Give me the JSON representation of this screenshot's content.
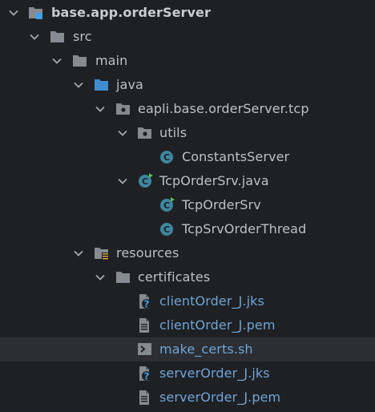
{
  "project_tree": {
    "root": {
      "label": "base.app.orderServer"
    },
    "src": {
      "label": "src"
    },
    "main": {
      "label": "main"
    },
    "java": {
      "label": "java"
    },
    "package": {
      "label": "eapli.base.orderServer.tcp"
    },
    "utils": {
      "label": "utils"
    },
    "constants_server": {
      "label": "ConstantsServer"
    },
    "tcp_order_srv_file": {
      "label": "TcpOrderSrv.java"
    },
    "tcp_order_srv_class": {
      "label": "TcpOrderSrv"
    },
    "tcp_srv_order_thread": {
      "label": "TcpSrvOrderThread"
    },
    "resources": {
      "label": "resources"
    },
    "certificates": {
      "label": "certificates"
    },
    "files": [
      {
        "label": "clientOrder_J.jks",
        "icon": "unknown-file-icon"
      },
      {
        "label": "clientOrder_J.pem",
        "icon": "text-file-icon"
      },
      {
        "label": "make_certs.sh",
        "icon": "shell-script-icon"
      },
      {
        "label": "serverOrder_J.jks",
        "icon": "unknown-file-icon"
      },
      {
        "label": "serverOrder_J.pem",
        "icon": "text-file-icon"
      }
    ]
  },
  "colors": {
    "background": "#1f2023",
    "selected_row": "#2c2e33",
    "text": "#bcc0c7",
    "vcs_modified_text": "#6ea4d8",
    "folder": "#868a91",
    "source_folder": "#3f8fd0",
    "class_icon": "#3e86a0",
    "module_badge": "#3aa1e8"
  }
}
